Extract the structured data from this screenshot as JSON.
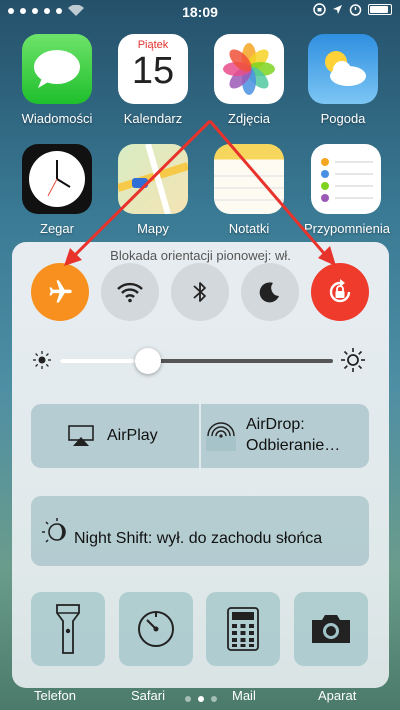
{
  "status_bar": {
    "time": "18:09"
  },
  "apps": [
    {
      "id": "messages",
      "label": "Wiadomości"
    },
    {
      "id": "calendar",
      "label": "Kalendarz",
      "day_name": "Piątek",
      "day_number": "15"
    },
    {
      "id": "photos",
      "label": "Zdjęcia"
    },
    {
      "id": "weather",
      "label": "Pogoda"
    },
    {
      "id": "clock",
      "label": "Zegar"
    },
    {
      "id": "maps",
      "label": "Mapy"
    },
    {
      "id": "notes",
      "label": "Notatki"
    },
    {
      "id": "reminders",
      "label": "Przypomnienia"
    }
  ],
  "control_center": {
    "hint": "Blokada orientacji pionowej: wł.",
    "toggles": [
      {
        "id": "airplane",
        "icon": "airplane-icon",
        "active": true,
        "color": "#f7901e"
      },
      {
        "id": "wifi",
        "icon": "wifi-icon",
        "active": false
      },
      {
        "id": "bluetooth",
        "icon": "bluetooth-icon",
        "active": false
      },
      {
        "id": "do-not-disturb",
        "icon": "moon-icon",
        "active": false
      },
      {
        "id": "orientation-lock",
        "icon": "rotation-lock-icon",
        "active": true,
        "color": "#ef3b2c"
      }
    ],
    "brightness": 0.28,
    "airplay_label": "AirPlay",
    "airdrop_line1": "AirDrop:",
    "airdrop_line2": "Odbieranie…",
    "night_shift_label": "Night Shift: wył. do zachodu słońca",
    "shortcuts": [
      "flashlight-icon",
      "timer-icon",
      "calculator-icon",
      "camera-icon"
    ]
  },
  "dock": {
    "labels": [
      "Telefon",
      "Safari",
      "Mail",
      "Aparat"
    ],
    "page_count": 3,
    "active_page": 1
  }
}
